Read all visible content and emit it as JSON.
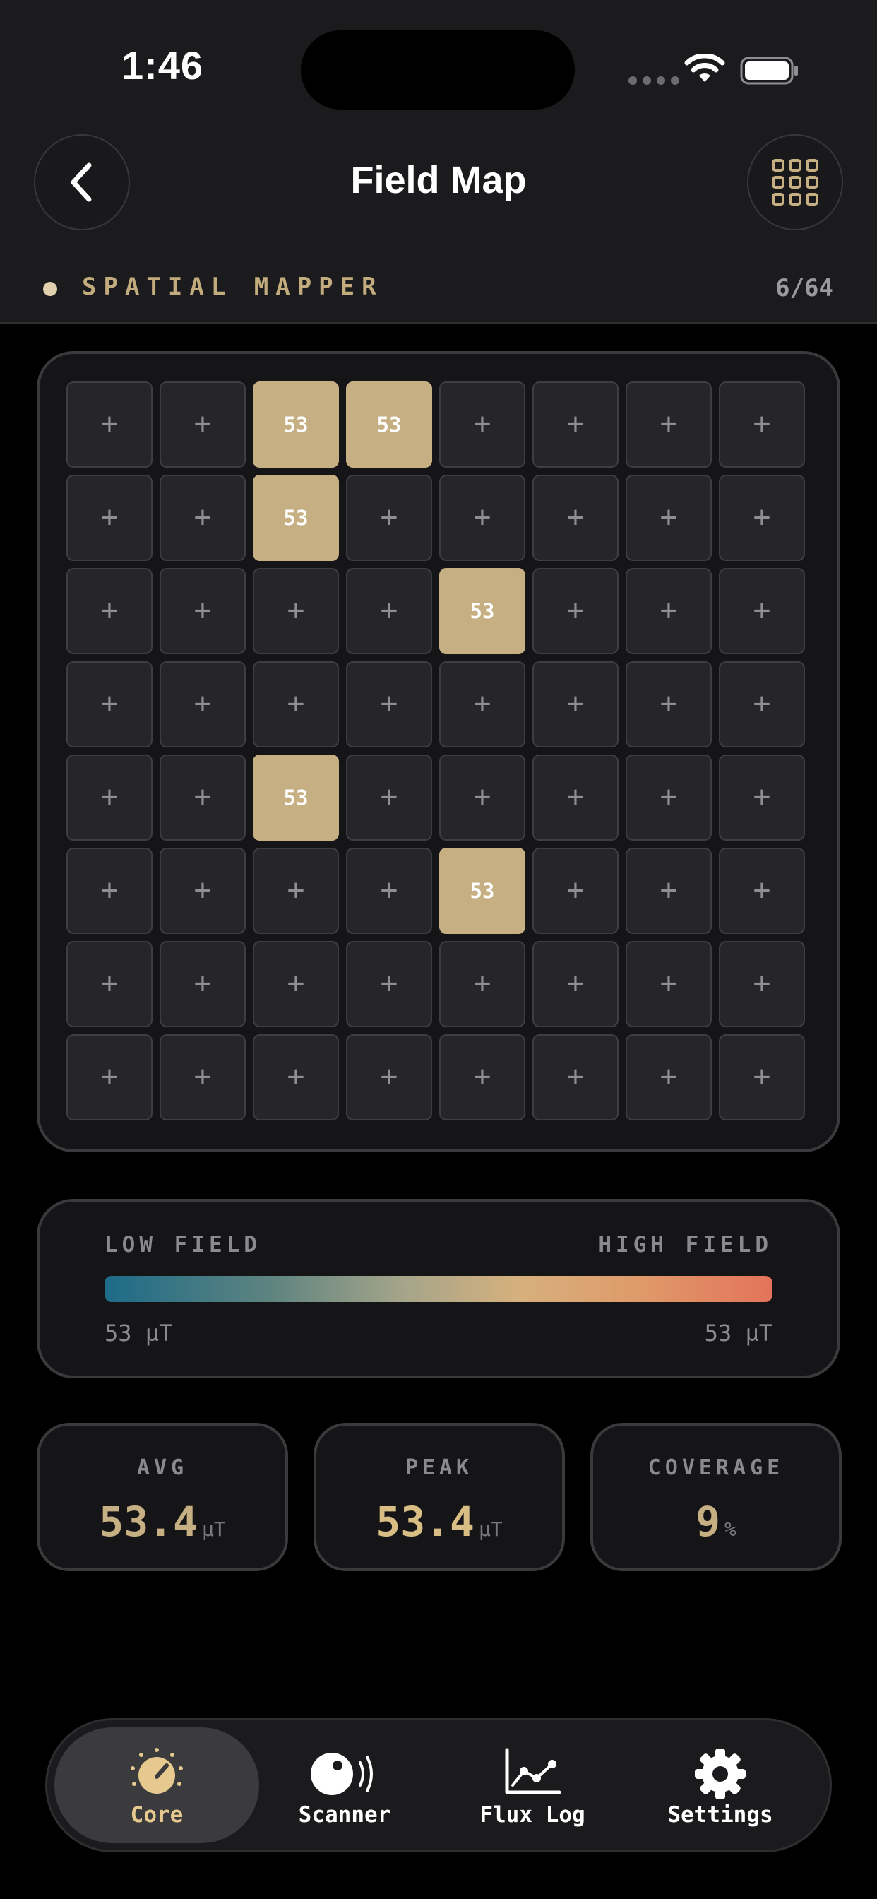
{
  "status_bar": {
    "time": "1:46"
  },
  "header": {
    "title": "Field Map"
  },
  "section": {
    "label": "SPATIAL MAPPER",
    "count": "6/64"
  },
  "field_map": {
    "empty_symbol": "+",
    "cells": [
      [
        "",
        "",
        "53",
        "53",
        "",
        "",
        "",
        ""
      ],
      [
        "",
        "",
        "53",
        "",
        "",
        "",
        "",
        ""
      ],
      [
        "",
        "",
        "",
        "",
        "53",
        "",
        "",
        ""
      ],
      [
        "",
        "",
        "",
        "",
        "",
        "",
        "",
        ""
      ],
      [
        "",
        "",
        "53",
        "",
        "",
        "",
        "",
        ""
      ],
      [
        "",
        "",
        "",
        "",
        "53",
        "",
        "",
        ""
      ],
      [
        "",
        "",
        "",
        "",
        "",
        "",
        "",
        ""
      ],
      [
        "",
        "",
        "",
        "",
        "",
        "",
        "",
        ""
      ]
    ]
  },
  "legend": {
    "low_label": "LOW FIELD",
    "high_label": "HIGH FIELD",
    "min_value": "53 µT",
    "max_value": "53 µT",
    "gradient_colors": [
      "#1d6b88",
      "#a6a58a",
      "#d6b07d",
      "#e3735a"
    ]
  },
  "stats": [
    {
      "label": "AVG",
      "value": "53.4",
      "unit": "µT"
    },
    {
      "label": "PEAK",
      "value": "53.4",
      "unit": "µT"
    },
    {
      "label": "COVERAGE",
      "value": "9",
      "unit": "%"
    }
  ],
  "tabs": [
    {
      "label": "Core",
      "icon": "core-gauge-icon",
      "active": true
    },
    {
      "label": "Scanner",
      "icon": "scanner-icon",
      "active": false
    },
    {
      "label": "Flux Log",
      "icon": "chart-line-icon",
      "active": false
    },
    {
      "label": "Settings",
      "icon": "gear-icon",
      "active": false
    }
  ],
  "colors": {
    "accent": "#c6af82",
    "active_tab_label": "#e6c98f",
    "cell_empty": "#262628",
    "background": "#000000"
  }
}
